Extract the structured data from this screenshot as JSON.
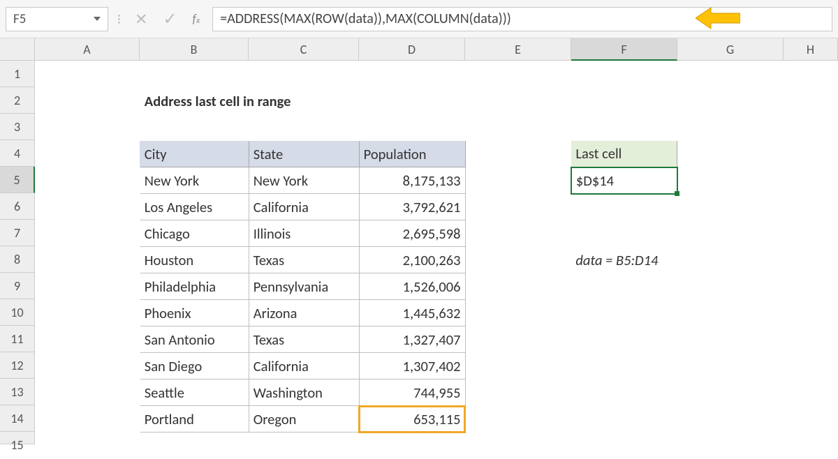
{
  "namebox": {
    "value": "F5"
  },
  "formula_bar": {
    "formula": "=ADDRESS(MAX(ROW(data)),MAX(COLUMN(data)))"
  },
  "columns": [
    "A",
    "B",
    "C",
    "D",
    "E",
    "F",
    "G",
    "H"
  ],
  "rows": [
    "1",
    "2",
    "3",
    "4",
    "5",
    "6",
    "7",
    "8",
    "9",
    "10",
    "11",
    "12",
    "13",
    "14",
    "15"
  ],
  "active": {
    "col_index": 5,
    "row_index": 4
  },
  "title": "Address last cell in range",
  "table": {
    "headers": [
      "City",
      "State",
      "Population"
    ],
    "rows": [
      [
        "New York",
        "New York",
        "8,175,133"
      ],
      [
        "Los Angeles",
        "California",
        "3,792,621"
      ],
      [
        "Chicago",
        "Illinois",
        "2,695,598"
      ],
      [
        "Houston",
        "Texas",
        "2,100,263"
      ],
      [
        "Philadelphia",
        "Pennsylvania",
        "1,526,006"
      ],
      [
        "Phoenix",
        "Arizona",
        "1,445,632"
      ],
      [
        "San Antonio",
        "Texas",
        "1,327,407"
      ],
      [
        "San Diego",
        "California",
        "1,307,402"
      ],
      [
        "Seattle",
        "Washington",
        "744,955"
      ],
      [
        "Portland",
        "Oregon",
        "653,115"
      ]
    ]
  },
  "result": {
    "label": "Last cell",
    "value": "$D$14"
  },
  "note": "data = B5:D14"
}
